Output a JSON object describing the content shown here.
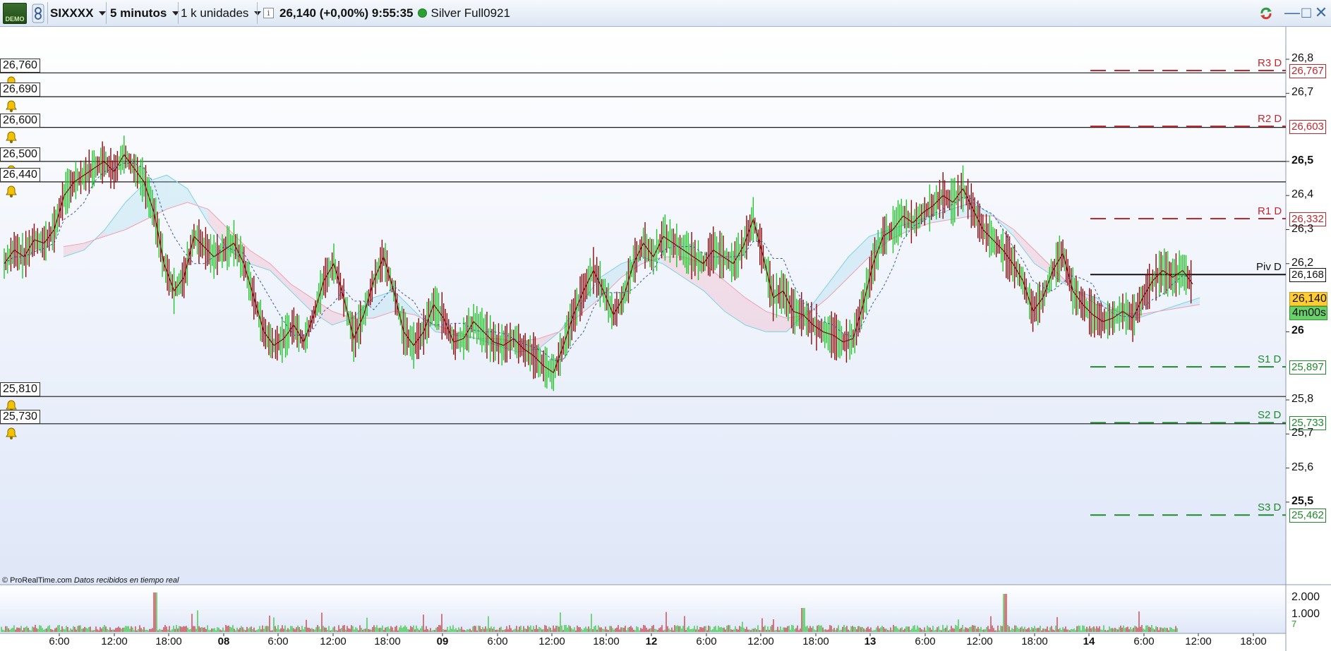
{
  "toolbar": {
    "logo_text": "DEMO",
    "instrument": "SIXXXX",
    "timeframe": "5 minutos",
    "units": "1 k unidades",
    "quote": "26,140 (+0,00%) 9:55:35",
    "account": "Silver Full0921",
    "icons": [
      "demo-logo-icon",
      "link-icon",
      "info-icon",
      "live-status-dot-icon",
      "refresh-icon",
      "minimize-icon",
      "maximize-icon",
      "close-icon"
    ]
  },
  "alerts": [
    {
      "label": "26,760",
      "price": 26.76
    },
    {
      "label": "26,690",
      "price": 26.69
    },
    {
      "label": "26,600",
      "price": 26.6
    },
    {
      "label": "26,500",
      "price": 26.5
    },
    {
      "label": "26,440",
      "price": 26.44
    },
    {
      "label": "25,810",
      "price": 25.81
    },
    {
      "label": "25,730",
      "price": 25.73
    }
  ],
  "y_axis": {
    "ticks": [
      {
        "label": "26,8",
        "value": 26.8,
        "bold": false
      },
      {
        "label": "26,7",
        "value": 26.7,
        "bold": false
      },
      {
        "label": "26,5",
        "value": 26.5,
        "bold": true
      },
      {
        "label": "26,4",
        "value": 26.4,
        "bold": false
      },
      {
        "label": "26,3",
        "value": 26.3,
        "bold": false
      },
      {
        "label": "26,2",
        "value": 26.2,
        "bold": false
      },
      {
        "label": "26",
        "value": 26.0,
        "bold": true
      },
      {
        "label": "25,8",
        "value": 25.8,
        "bold": false
      },
      {
        "label": "25,7",
        "value": 25.7,
        "bold": false
      },
      {
        "label": "25,6",
        "value": 25.6,
        "bold": false
      },
      {
        "label": "25,5",
        "value": 25.5,
        "bold": true
      }
    ]
  },
  "pivots": [
    {
      "name": "R3 D",
      "value_label": "26,767",
      "value": 26.767,
      "color": "#c0282d",
      "line": "dashed"
    },
    {
      "name": "R2 D",
      "value_label": "26,603",
      "value": 26.603,
      "color": "#c0282d",
      "line": "dashed"
    },
    {
      "name": "R1 D",
      "value_label": "26,332",
      "value": 26.332,
      "color": "#c0282d",
      "line": "dashed"
    },
    {
      "name": "Piv D",
      "value_label": "26,168",
      "value": 26.168,
      "color": "#111111",
      "line": "solid"
    },
    {
      "name": "S1 D",
      "value_label": "25,897",
      "value": 25.897,
      "color": "#1f8a2c",
      "line": "dashed"
    },
    {
      "name": "S2 D",
      "value_label": "25,733",
      "value": 25.733,
      "color": "#1f8a2c",
      "line": "dashed"
    },
    {
      "name": "S3 D",
      "value_label": "25,462",
      "value": 25.462,
      "color": "#1f8a2c",
      "line": "dashed"
    }
  ],
  "current": {
    "price_label": "26,140",
    "price": 26.14,
    "timer": "4m00s"
  },
  "credit": {
    "brand": "© ProRealTime.com",
    "note": "Datos recibidos en tiempo real"
  },
  "volume_axis": {
    "labels": [
      "2.000",
      "1.000"
    ],
    "values": [
      2000,
      1000
    ],
    "small": "7"
  },
  "x_axis": {
    "labels": [
      {
        "label": "6:00",
        "bold": false
      },
      {
        "label": "12:00",
        "bold": false
      },
      {
        "label": "18:00",
        "bold": false
      },
      {
        "label": "08",
        "bold": true
      },
      {
        "label": "6:00",
        "bold": false
      },
      {
        "label": "12:00",
        "bold": false
      },
      {
        "label": "18:00",
        "bold": false
      },
      {
        "label": "09",
        "bold": true
      },
      {
        "label": "6:00",
        "bold": false
      },
      {
        "label": "12:00",
        "bold": false
      },
      {
        "label": "18:00",
        "bold": false
      },
      {
        "label": "12",
        "bold": true
      },
      {
        "label": "6:00",
        "bold": false
      },
      {
        "label": "12:00",
        "bold": false
      },
      {
        "label": "18:00",
        "bold": false
      },
      {
        "label": "13",
        "bold": true
      },
      {
        "label": "6:00",
        "bold": false
      },
      {
        "label": "12:00",
        "bold": false
      },
      {
        "label": "18:00",
        "bold": false
      },
      {
        "label": "14",
        "bold": true
      },
      {
        "label": "6:00",
        "bold": false
      },
      {
        "label": "12:00",
        "bold": false
      },
      {
        "label": "18:00",
        "bold": false
      }
    ]
  },
  "chart_data": {
    "type": "line",
    "instrument": "SIXXXX",
    "timeframe": "5 minutos",
    "ylim": [
      25.45,
      26.82
    ],
    "x_start_bar": 0,
    "bars_per_session": 288,
    "price_series": [
      26.2,
      26.24,
      26.22,
      26.27,
      26.26,
      26.3,
      26.4,
      26.44,
      26.46,
      26.48,
      26.5,
      26.47,
      26.52,
      26.48,
      26.44,
      26.35,
      26.2,
      26.12,
      26.16,
      26.28,
      26.25,
      26.22,
      26.24,
      26.26,
      26.2,
      26.1,
      26.0,
      25.96,
      25.98,
      26.02,
      25.97,
      26.05,
      26.15,
      26.2,
      26.1,
      25.98,
      26.05,
      26.15,
      26.22,
      26.12,
      26.0,
      25.96,
      26.0,
      26.08,
      26.04,
      25.97,
      25.98,
      26.03,
      26.0,
      25.97,
      25.96,
      25.98,
      25.95,
      25.93,
      25.9,
      25.88,
      25.96,
      26.05,
      26.12,
      26.18,
      26.12,
      26.05,
      26.1,
      26.2,
      26.26,
      26.22,
      26.28,
      26.26,
      26.24,
      26.22,
      26.2,
      26.24,
      26.22,
      26.2,
      26.25,
      26.33,
      26.22,
      26.1,
      26.12,
      26.06,
      26.05,
      26.02,
      26.0,
      25.99,
      25.97,
      25.98,
      26.08,
      26.2,
      26.28,
      26.3,
      26.34,
      26.32,
      26.35,
      26.37,
      26.4,
      26.38,
      26.42,
      26.36,
      26.3,
      26.27,
      26.24,
      26.2,
      26.15,
      26.06,
      26.1,
      26.18,
      26.23,
      26.12,
      26.08,
      26.05,
      26.03,
      26.04,
      26.06,
      26.04,
      26.1,
      26.15,
      26.18,
      26.16,
      26.18,
      26.14
    ],
    "ichimoku_span_a": [
      26.22,
      26.24,
      26.3,
      26.38,
      26.44,
      26.46,
      26.42,
      26.32,
      26.24,
      26.2,
      26.18,
      26.12,
      26.06,
      26.02,
      26.04,
      26.1,
      26.12,
      26.06,
      26.0,
      25.99,
      25.98,
      25.96,
      25.94,
      25.95,
      26.0,
      26.08,
      26.16,
      26.2,
      26.22,
      26.2,
      26.16,
      26.12,
      26.06,
      26.02,
      26.0,
      26.0,
      26.06,
      26.14,
      26.22,
      26.28,
      26.3,
      26.32,
      26.34,
      26.36,
      26.38,
      26.34,
      26.28,
      26.2,
      26.16,
      26.12,
      26.1,
      26.06,
      26.04,
      26.06,
      26.08,
      26.1
    ],
    "ichimoku_span_b": [
      26.25,
      26.26,
      26.28,
      26.3,
      26.33,
      26.36,
      26.38,
      26.36,
      26.3,
      26.24,
      26.2,
      26.14,
      26.1,
      26.06,
      26.04,
      26.04,
      26.06,
      26.05,
      26.02,
      26.0,
      25.98,
      25.98,
      25.97,
      25.98,
      26.0,
      26.05,
      26.1,
      26.16,
      26.2,
      26.22,
      26.22,
      26.2,
      26.15,
      26.1,
      26.06,
      26.04,
      26.05,
      26.1,
      26.16,
      26.22,
      26.27,
      26.3,
      26.32,
      26.33,
      26.34,
      26.34,
      26.3,
      26.24,
      26.18,
      26.12,
      26.08,
      26.06,
      26.05,
      26.06,
      26.07,
      26.08
    ],
    "volume_max": 2500
  }
}
